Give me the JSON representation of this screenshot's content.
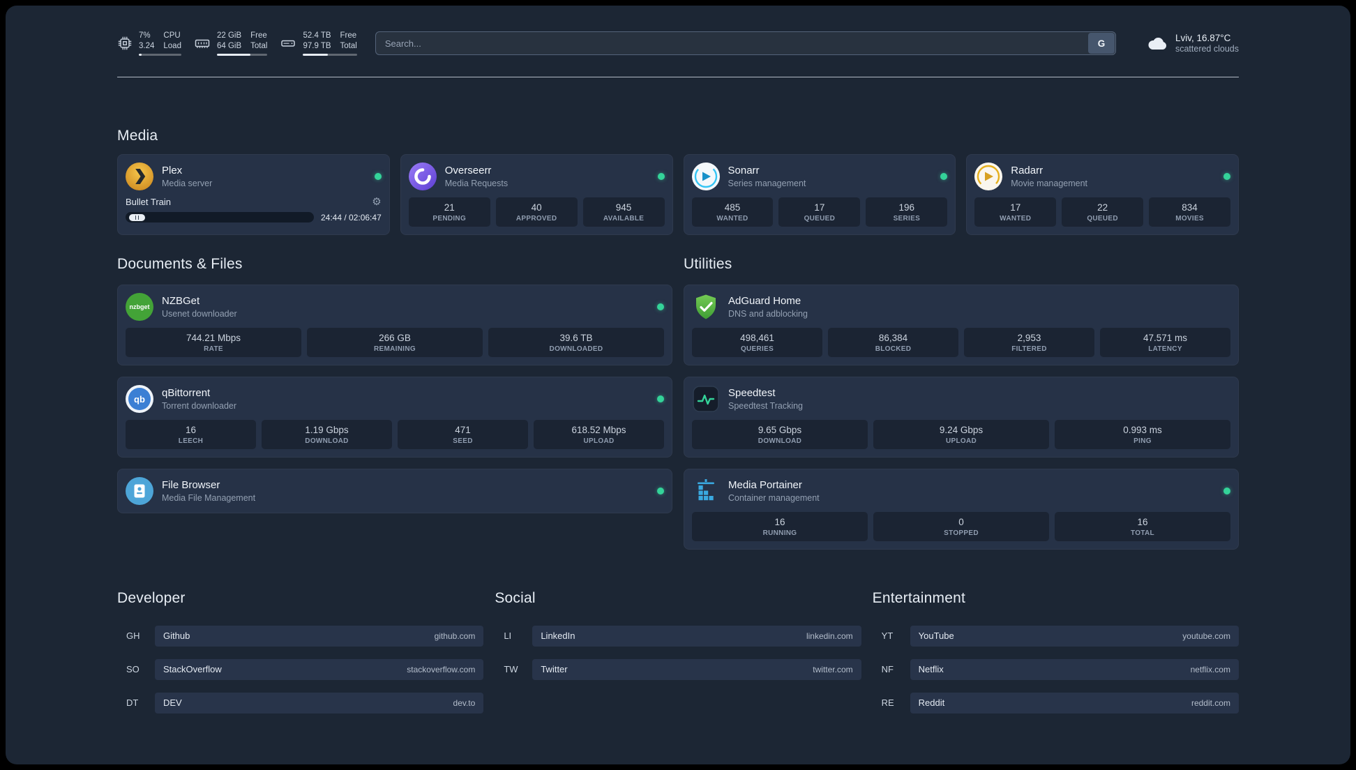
{
  "colors": {
    "background": "#1c2634",
    "card": "#263247",
    "status_online": "#34d399",
    "accent_green_pulse": "#34d399",
    "portainer_blue": "#3aa9e0"
  },
  "topbar": {
    "resources": [
      {
        "icon": "cpu-icon",
        "values": [
          "7%",
          "3.24"
        ],
        "labels": [
          "CPU",
          "Load"
        ],
        "bar_percent": 7
      },
      {
        "icon": "memory-icon",
        "values": [
          "22 GiB",
          "64 GiB"
        ],
        "labels": [
          "Free",
          "Total"
        ],
        "bar_percent": 66
      },
      {
        "icon": "disk-icon",
        "values": [
          "52.4 TB",
          "97.9 TB"
        ],
        "labels": [
          "Free",
          "Total"
        ],
        "bar_percent": 46
      }
    ],
    "search": {
      "placeholder": "Search...",
      "provider_button": "G"
    },
    "weather": {
      "location": "Lviv, 16.87°C",
      "condition": "scattered clouds"
    }
  },
  "sections": {
    "media": {
      "title": "Media",
      "plex": {
        "name": "Plex",
        "desc": "Media server",
        "status": "online",
        "player": {
          "title": "Bullet Train",
          "time": "24:44 / 02:06:47"
        }
      },
      "overseerr": {
        "name": "Overseerr",
        "desc": "Media Requests",
        "status": "online",
        "stats": [
          {
            "value": "21",
            "label": "PENDING"
          },
          {
            "value": "40",
            "label": "APPROVED"
          },
          {
            "value": "945",
            "label": "AVAILABLE"
          }
        ]
      },
      "sonarr": {
        "name": "Sonarr",
        "desc": "Series management",
        "status": "online",
        "stats": [
          {
            "value": "485",
            "label": "WANTED"
          },
          {
            "value": "17",
            "label": "QUEUED"
          },
          {
            "value": "196",
            "label": "SERIES"
          }
        ]
      },
      "radarr": {
        "name": "Radarr",
        "desc": "Movie management",
        "status": "online",
        "stats": [
          {
            "value": "17",
            "label": "WANTED"
          },
          {
            "value": "22",
            "label": "QUEUED"
          },
          {
            "value": "834",
            "label": "MOVIES"
          }
        ]
      }
    },
    "documents": {
      "title": "Documents & Files",
      "nzbget": {
        "name": "NZBGet",
        "desc": "Usenet downloader",
        "status": "online",
        "stats": [
          {
            "value": "744.21 Mbps",
            "label": "RATE"
          },
          {
            "value": "266 GB",
            "label": "REMAINING"
          },
          {
            "value": "39.6 TB",
            "label": "DOWNLOADED"
          }
        ]
      },
      "qbittorrent": {
        "name": "qBittorrent",
        "desc": "Torrent downloader",
        "status": "online",
        "stats": [
          {
            "value": "16",
            "label": "LEECH"
          },
          {
            "value": "1.19 Gbps",
            "label": "DOWNLOAD"
          },
          {
            "value": "471",
            "label": "SEED"
          },
          {
            "value": "618.52 Mbps",
            "label": "UPLOAD"
          }
        ]
      },
      "filebrowser": {
        "name": "File Browser",
        "desc": "Media File Management",
        "status": "online"
      }
    },
    "utilities": {
      "title": "Utilities",
      "adguard": {
        "name": "AdGuard Home",
        "desc": "DNS and adblocking",
        "stats": [
          {
            "value": "498,461",
            "label": "QUERIES"
          },
          {
            "value": "86,384",
            "label": "BLOCKED"
          },
          {
            "value": "2,953",
            "label": "FILTERED"
          },
          {
            "value": "47.571 ms",
            "label": "LATENCY"
          }
        ]
      },
      "speedtest": {
        "name": "Speedtest",
        "desc": "Speedtest Tracking",
        "stats": [
          {
            "value": "9.65 Gbps",
            "label": "DOWNLOAD"
          },
          {
            "value": "9.24 Gbps",
            "label": "UPLOAD"
          },
          {
            "value": "0.993 ms",
            "label": "PING"
          }
        ]
      },
      "portainer": {
        "name": "Media Portainer",
        "desc": "Container management",
        "status": "online",
        "stats": [
          {
            "value": "16",
            "label": "RUNNING"
          },
          {
            "value": "0",
            "label": "STOPPED"
          },
          {
            "value": "16",
            "label": "TOTAL"
          }
        ]
      }
    }
  },
  "bookmarks": [
    {
      "title": "Developer",
      "links": [
        {
          "abbr": "GH",
          "name": "Github",
          "url": "github.com"
        },
        {
          "abbr": "SO",
          "name": "StackOverflow",
          "url": "stackoverflow.com"
        },
        {
          "abbr": "DT",
          "name": "DEV",
          "url": "dev.to"
        }
      ]
    },
    {
      "title": "Social",
      "links": [
        {
          "abbr": "LI",
          "name": "LinkedIn",
          "url": "linkedin.com"
        },
        {
          "abbr": "TW",
          "name": "Twitter",
          "url": "twitter.com"
        }
      ]
    },
    {
      "title": "Entertainment",
      "links": [
        {
          "abbr": "YT",
          "name": "YouTube",
          "url": "youtube.com"
        },
        {
          "abbr": "NF",
          "name": "Netflix",
          "url": "netflix.com"
        },
        {
          "abbr": "RE",
          "name": "Reddit",
          "url": "reddit.com"
        }
      ]
    }
  ]
}
